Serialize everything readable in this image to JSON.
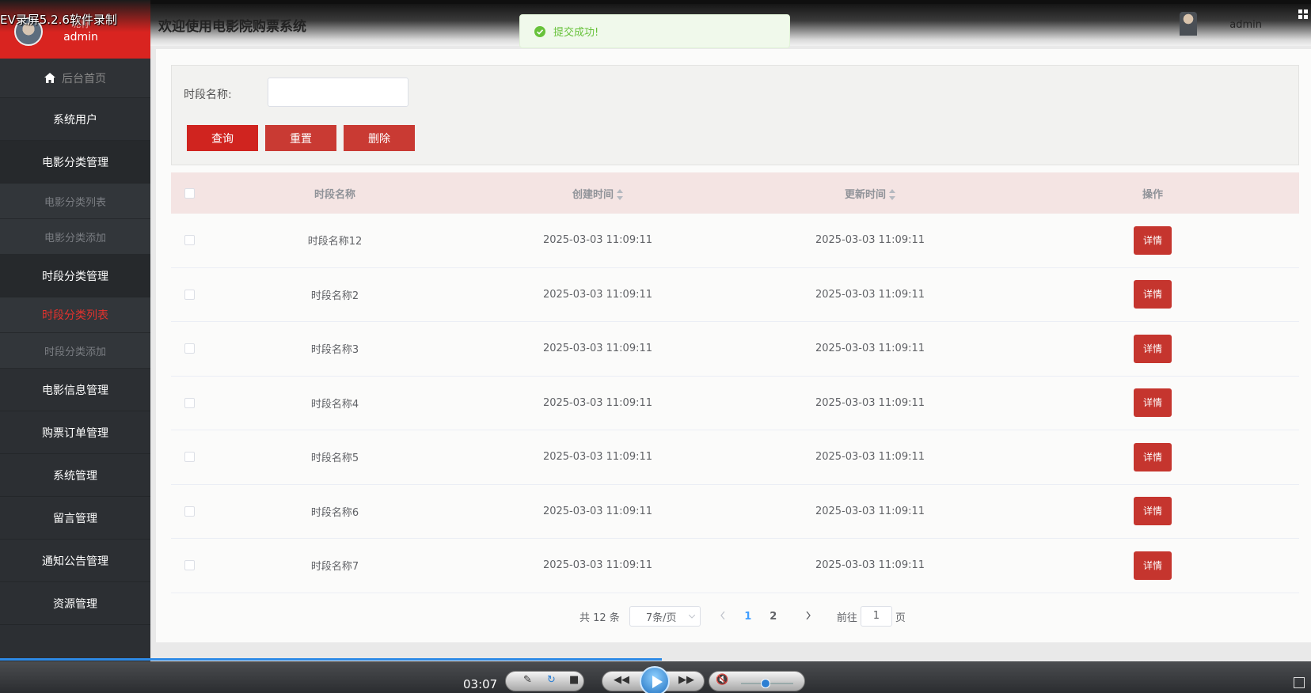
{
  "recorder": {
    "title": "EV录屏5.2.6软件录制",
    "time": "03:07"
  },
  "sidebar": {
    "nickname": "昵称",
    "username": "admin",
    "home": "后台首页",
    "items": [
      {
        "label": "系统用户"
      },
      {
        "label": "电影分类管理"
      },
      {
        "label": "电影分类列表"
      },
      {
        "label": "电影分类添加"
      },
      {
        "label": "时段分类管理"
      },
      {
        "label": "时段分类列表"
      },
      {
        "label": "时段分类添加"
      },
      {
        "label": "电影信息管理"
      },
      {
        "label": "购票订单管理"
      },
      {
        "label": "系统管理"
      },
      {
        "label": "留言管理"
      },
      {
        "label": "通知公告管理"
      },
      {
        "label": "资源管理"
      }
    ]
  },
  "header": {
    "title": "欢迎使用电影院购票系统",
    "user": "admin"
  },
  "toast": {
    "message": "提交成功!",
    "color": "#67c23a"
  },
  "search": {
    "label": "时段名称:",
    "value": "",
    "query_label": "查询",
    "reset_label": "重置",
    "delete_label": "删除"
  },
  "table": {
    "columns": {
      "name": "时段名称",
      "created": "创建时间",
      "updated": "更新时间",
      "ops": "操作"
    },
    "detail_label": "详情",
    "rows": [
      {
        "name": "时段名称12",
        "created": "2025-03-03 11:09:11",
        "updated": "2025-03-03 11:09:11"
      },
      {
        "name": "时段名称2",
        "created": "2025-03-03 11:09:11",
        "updated": "2025-03-03 11:09:11"
      },
      {
        "name": "时段名称3",
        "created": "2025-03-03 11:09:11",
        "updated": "2025-03-03 11:09:11"
      },
      {
        "name": "时段名称4",
        "created": "2025-03-03 11:09:11",
        "updated": "2025-03-03 11:09:11"
      },
      {
        "name": "时段名称5",
        "created": "2025-03-03 11:09:11",
        "updated": "2025-03-03 11:09:11"
      },
      {
        "name": "时段名称6",
        "created": "2025-03-03 11:09:11",
        "updated": "2025-03-03 11:09:11"
      },
      {
        "name": "时段名称7",
        "created": "2025-03-03 11:09:11",
        "updated": "2025-03-03 11:09:11"
      }
    ]
  },
  "pagination": {
    "total": "共 12 条",
    "page_size": "7条/页",
    "pages": [
      "1",
      "2"
    ],
    "current": "1",
    "goto_prefix": "前往",
    "goto_value": "1",
    "goto_suffix": "页"
  },
  "colors": {
    "accent": "#d0241f",
    "sidebar_bg": "#2c2f33",
    "active_menu": "#e5322d",
    "table_header_bg": "#f4e4e3"
  }
}
